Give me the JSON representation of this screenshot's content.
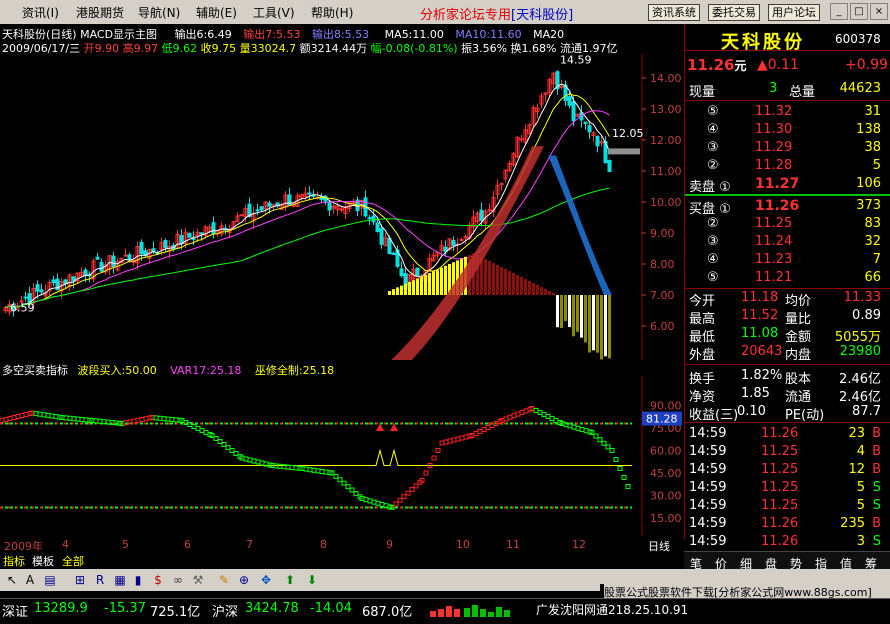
{
  "menu": [
    "资讯(I)",
    "港股期货",
    "导航(N)",
    "辅助(E)",
    "工具(V)",
    "帮助(H)"
  ],
  "forum": {
    "prefix": "分析家论坛专用",
    "bracket": "[天科股份]"
  },
  "sys_buttons": [
    "资讯系统",
    "委托交易",
    "用户论坛"
  ],
  "win_buttons": [
    "_",
    "□",
    "×"
  ],
  "chart": {
    "header": "天科股份(日线) MACD显示主图",
    "out1": "输出6:6.49",
    "out2": "输出7:5.53",
    "out3": "输出8:5.53",
    "ma5": "MA5:11.00",
    "ma10": "MA10:11.60",
    "ma20": "MA20",
    "quote": {
      "date": "2009/06/17/三",
      "open": "开9.90",
      "high": "高9.97",
      "low": "低9.62",
      "close": "收9.75",
      "vol": "量33024.7",
      "amount": "额3214.44万",
      "change": "幅-0.08(-0.81%)",
      "amplitude": "振3.56%",
      "turnover": "换1.68%",
      "float": "流通1.97亿"
    },
    "high_label": "14.59",
    "low_label": "6.59",
    "cur_label": "12.05",
    "price_ticks": [
      "14.00",
      "13.00",
      "12.00",
      "11.00",
      "10.00",
      "9.00",
      "8.00",
      "7.00",
      "6.00"
    ],
    "months": [
      "2009年",
      "4",
      "5",
      "6",
      "7",
      "8",
      "9",
      "10",
      "11",
      "12"
    ],
    "period": "日线"
  },
  "indicator": {
    "name": "多空买卖指标",
    "buy": "波段买入:50.00",
    "var17": "VAR17:25.18",
    "wx": "巫修全制:25.18",
    "ticks": [
      "90.00",
      "75.00",
      "60.00",
      "45.00",
      "30.00",
      "15.00"
    ],
    "marker": "81.28"
  },
  "panel": {
    "name": "天科股份",
    "code": "600378",
    "price": "11.26",
    "unit": "元",
    "change": "▲0.11",
    "change2": "+0.99",
    "nowvol_label": "现量",
    "nowvol": "3",
    "totvol_label": "总量",
    "totvol": "44623",
    "sells": [
      {
        "lvl": "⑤",
        "p": "11.32",
        "v": "31"
      },
      {
        "lvl": "④",
        "p": "11.30",
        "v": "138"
      },
      {
        "lvl": "③",
        "p": "11.29",
        "v": "38"
      },
      {
        "lvl": "②",
        "p": "11.28",
        "v": "5"
      },
      {
        "lvl": "卖盘 ①",
        "p": "11.27",
        "v": "106"
      }
    ],
    "buys": [
      {
        "lvl": "买盘 ①",
        "p": "11.26",
        "v": "373"
      },
      {
        "lvl": "②",
        "p": "11.25",
        "v": "83"
      },
      {
        "lvl": "③",
        "p": "11.24",
        "v": "32"
      },
      {
        "lvl": "④",
        "p": "11.23",
        "v": "7"
      },
      {
        "lvl": "⑤",
        "p": "11.21",
        "v": "66"
      }
    ],
    "stats": [
      {
        "a": "今开",
        "av": "11.18",
        "b": "均价",
        "bv": "11.33"
      },
      {
        "a": "最高",
        "av": "11.52",
        "b": "量比",
        "bv": "0.89"
      },
      {
        "a": "最低",
        "av": "11.08",
        "b": "金额",
        "bv": "5055万"
      },
      {
        "a": "外盘",
        "av": "20643",
        "b": "内盘",
        "bv": "23980"
      }
    ],
    "stats2": [
      {
        "a": "换手",
        "av": "1.82%",
        "b": "股本",
        "bv": "2.46亿"
      },
      {
        "a": "净资",
        "av": "1.85",
        "b": "流通",
        "bv": "2.46亿"
      },
      {
        "a": "收益(三)",
        "av": "0.10",
        "b": "PE(动)",
        "bv": "87.7"
      }
    ],
    "ticks": [
      {
        "t": "14:59",
        "p": "11.26",
        "v": "23",
        "s": "B"
      },
      {
        "t": "14:59",
        "p": "11.25",
        "v": "4",
        "s": "B"
      },
      {
        "t": "14:59",
        "p": "11.25",
        "v": "12",
        "s": "B"
      },
      {
        "t": "14:59",
        "p": "11.25",
        "v": "5",
        "s": "S"
      },
      {
        "t": "14:59",
        "p": "11.25",
        "v": "5",
        "s": "S"
      },
      {
        "t": "14:59",
        "p": "11.26",
        "v": "235",
        "s": "B"
      },
      {
        "t": "14:59",
        "p": "11.26",
        "v": "3",
        "s": "S"
      }
    ],
    "tabs": [
      "笔",
      "价",
      "细",
      "盘",
      "势",
      "指",
      "值",
      "筹"
    ]
  },
  "bottom_tabs": [
    "指标",
    "模板",
    "全部"
  ],
  "status": {
    "sz_label": "深证",
    "sz_val": "13289.9",
    "sz_chg": "-15.37",
    "sz_amt": "725.1亿",
    "sh_label": "沪深",
    "sh_val": "3424.78",
    "sh_chg": "-14.04",
    "sh_amt": "687.0亿",
    "ad": "股票公式股票软件下载[分析家公式网www.88gs.com]",
    "server": "广发沈阳网通218.25.10.91"
  },
  "colors": {
    "up": "#ff3232",
    "down": "#00e0e0",
    "yellow": "#ffff00",
    "bg": "#000000"
  }
}
